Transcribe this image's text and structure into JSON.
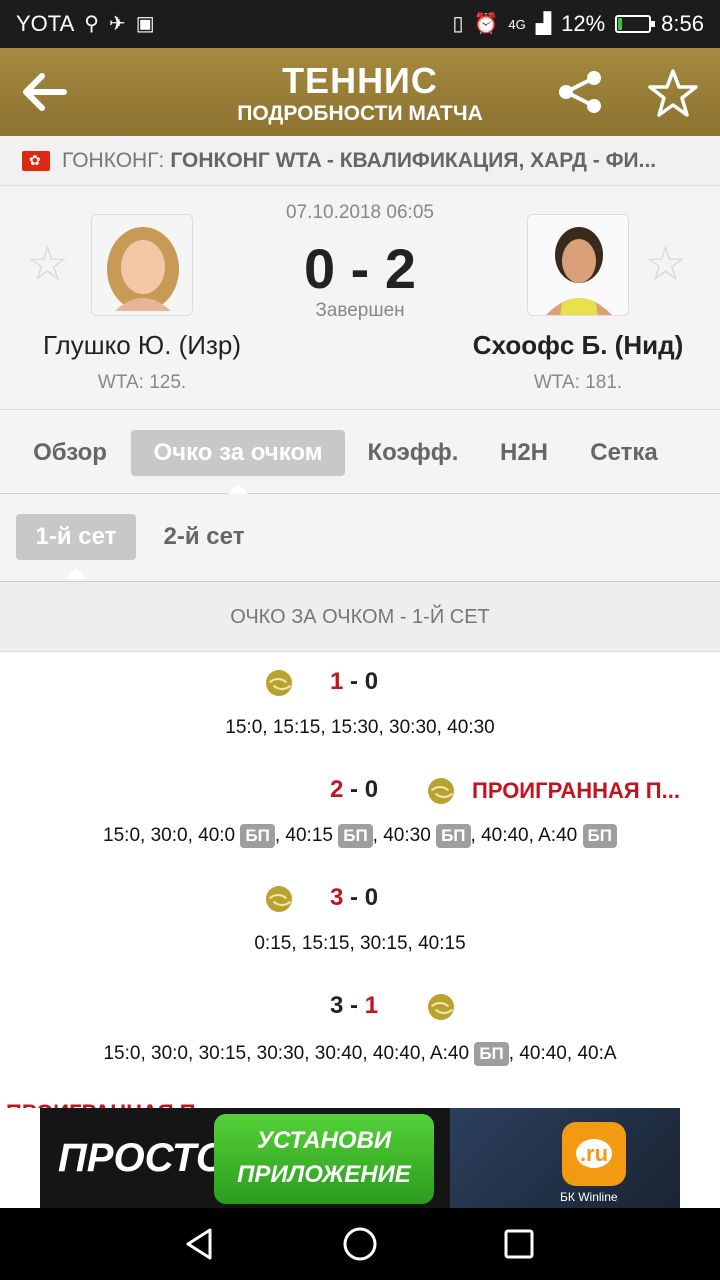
{
  "status_bar": {
    "carrier": "YOTA",
    "network": "4G",
    "battery_percent": "12%",
    "battery_level": 0.12,
    "time": "8:56"
  },
  "app_bar": {
    "title": "ТЕННИС",
    "subtitle": "ПОДРОБНОСТИ МАТЧА",
    "icons": [
      "back-arrow-icon",
      "share-icon",
      "star-outline-icon"
    ]
  },
  "breadcrumb": {
    "country": "ГОНКОНГ:",
    "tournament": "ГОНКОНГ WTA - КВАЛИФИКАЦИЯ, ХАРД - ФИ..."
  },
  "match": {
    "date": "07.10.2018 06:05",
    "score": "0 - 2",
    "status": "Завершен",
    "home": {
      "name": "Глушко Ю. (Изр)",
      "rank": "WTA: 125."
    },
    "away": {
      "name": "Схоофс Б. (Нид)",
      "rank": "WTA: 181."
    }
  },
  "tabs": [
    "Обзор",
    "Очко за очком",
    "Коэфф.",
    "H2H",
    "Сетка"
  ],
  "active_tab": "Очко за очком",
  "set_tabs": [
    "1-й сет",
    "2-й сет"
  ],
  "active_set": "1-й сет",
  "section_title": "ОЧКО ЗА ОЧКОМ - 1-Й СЕТ",
  "lost_serve_label": "ПРОИГРАННАЯ П...",
  "bp_label": "БП",
  "games": [
    {
      "home": "1",
      "away": "0",
      "server": "home",
      "points": [
        "15:0",
        "15:15",
        "15:30",
        "30:30",
        "40:30"
      ]
    },
    {
      "home": "2",
      "away": "0",
      "server": "away",
      "lost_serve": true,
      "points": [
        "15:0",
        "30:0",
        "40:0",
        "40:15",
        "40:30",
        "40:40",
        "A:40"
      ]
    },
    {
      "home": "3",
      "away": "0",
      "server": "home",
      "points": [
        "0:15",
        "15:15",
        "30:15",
        "40:15"
      ]
    },
    {
      "home": "3",
      "away": "1",
      "server": "away",
      "points": [
        "15:0",
        "30:0",
        "30:15",
        "30:30",
        "30:40",
        "40:40",
        "A:40",
        "40:40",
        "40:A"
      ]
    }
  ],
  "ad": {
    "text_left": "ПРОСТО",
    "button_line1": "УСТАНОВИ",
    "button_line2": "ПРИЛОЖЕНИЕ",
    "logo": ".ru",
    "caption": "БК Winline"
  },
  "colors": {
    "app_bar": "#9a7f38",
    "accent_red": "#c0141e",
    "ball": "#b9a22e",
    "tab_active": "#c8c8c8"
  }
}
